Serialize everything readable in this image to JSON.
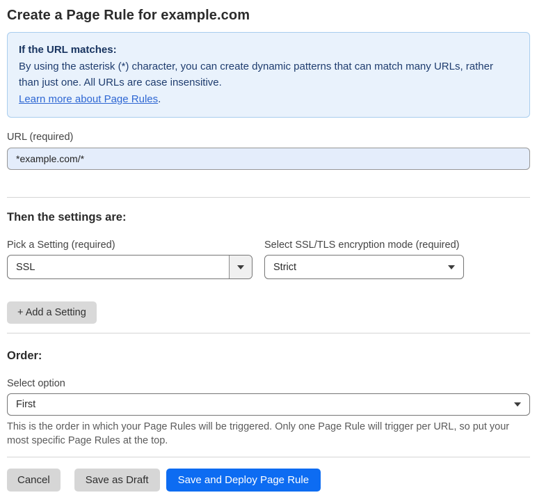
{
  "page": {
    "title": "Create a Page Rule for example.com"
  },
  "info_box": {
    "heading": "If the URL matches:",
    "body": "By using the asterisk (*) character, you can create dynamic patterns that can match many URLs, rather than just one. All URLs are case insensitive.",
    "link_label": "Learn more about Page Rules",
    "link_suffix": "."
  },
  "url_field": {
    "label": "URL (required)",
    "value": "*example.com/*"
  },
  "settings_section": {
    "heading": "Then the settings are:",
    "setting_select": {
      "label": "Pick a Setting (required)",
      "value": "SSL"
    },
    "mode_select": {
      "label": "Select SSL/TLS encryption mode (required)",
      "value": "Strict"
    },
    "add_setting_label": "+ Add a Setting"
  },
  "order_section": {
    "heading": "Order:",
    "select_label": "Select option",
    "select_value": "First",
    "help_text": "This is the order in which your Page Rules will be triggered. Only one Page Rule will trigger per URL, so put your most specific Page Rules at the top."
  },
  "footer": {
    "cancel_label": "Cancel",
    "save_draft_label": "Save as Draft",
    "save_deploy_label": "Save and Deploy Page Rule"
  },
  "colors": {
    "accent_blue": "#0d6cf2",
    "info_background": "#e9f2fc",
    "info_border": "#a9cdee",
    "info_text": "#1e3c6e",
    "link_blue": "#2e67d3",
    "url_input_background": "#e4edfb",
    "gray_button": "#d6d6d6",
    "divider": "#d5d5d5"
  }
}
